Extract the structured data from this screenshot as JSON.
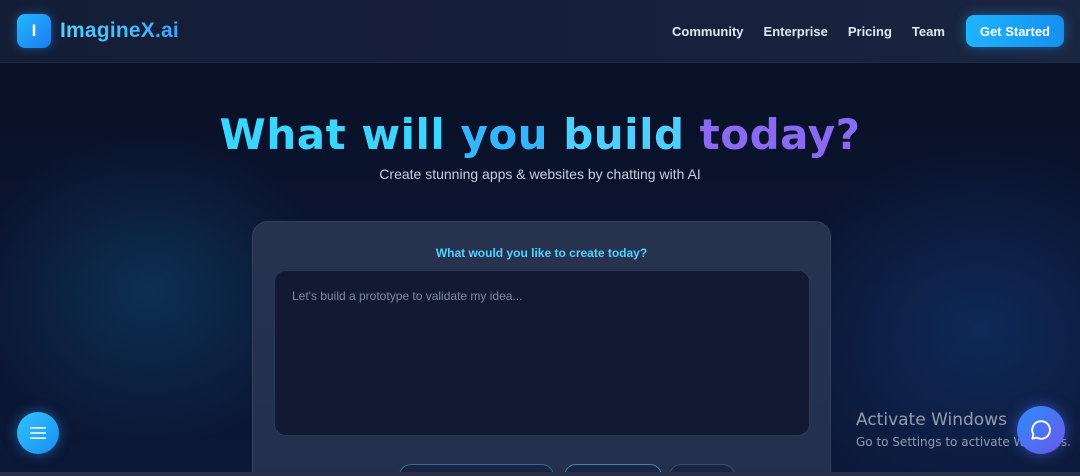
{
  "header": {
    "logo_letter": "I",
    "brand_name": "ImagineX.ai",
    "nav": [
      "Community",
      "Enterprise",
      "Pricing",
      "Team"
    ],
    "cta_label": "Get Started"
  },
  "hero": {
    "title_words": [
      "What",
      "will",
      "you",
      "build",
      "today?"
    ],
    "subtitle": "Create stunning apps & websites by chatting with AI"
  },
  "card": {
    "label": "What would you like to create today?",
    "prompt_placeholder": "Let's build a prototype to validate my idea..."
  },
  "watermark": {
    "title": "Activate Windows",
    "subtitle": "Go to Settings to activate Windows."
  },
  "icons": {
    "menu": "menu-icon",
    "chat": "chat-bubble-icon"
  },
  "colors": {
    "accent": "#1fb4ff",
    "title_purple": "#8a6af2",
    "background": "#0b1226"
  }
}
